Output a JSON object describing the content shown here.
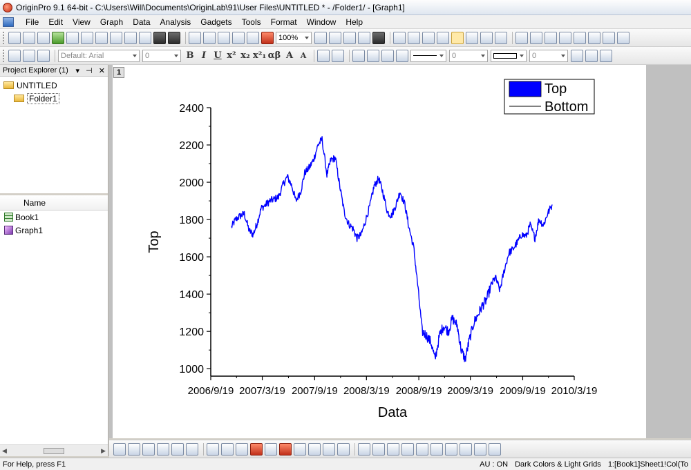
{
  "window": {
    "title": "OriginPro 9.1 64-bit - C:\\Users\\Will\\Documents\\OriginLab\\91\\User Files\\UNTITLED * - /Folder1/ - [Graph1]"
  },
  "menu": [
    "File",
    "Edit",
    "View",
    "Graph",
    "Data",
    "Analysis",
    "Gadgets",
    "Tools",
    "Format",
    "Window",
    "Help"
  ],
  "toolbar": {
    "zoom": "100%",
    "font": "Default: Arial",
    "font_size": "0",
    "line_width": "0",
    "fill_size": "0"
  },
  "format_buttons": [
    "B",
    "I",
    "U",
    "x²",
    "x₂",
    "x²₁",
    "αβ",
    "A",
    "A"
  ],
  "explorer": {
    "title": "Project Explorer (1)",
    "root": "UNTITLED",
    "folder": "Folder1",
    "list_header": "Name",
    "items": [
      {
        "name": "Book1",
        "icon": "workbook-icon"
      },
      {
        "name": "Graph1",
        "icon": "graph-icon"
      }
    ]
  },
  "graph": {
    "layer_label": "1"
  },
  "status": {
    "help": "For Help, press F1",
    "au": "AU : ON",
    "theme": "Dark Colors & Light Grids",
    "ref": "1:[Book1]Sheet1!Col(To"
  },
  "chart_data": {
    "type": "line",
    "title": "",
    "xlabel": "Data",
    "ylabel": "Top",
    "x_ticks": [
      "2006/9/19",
      "2007/3/19",
      "2007/9/19",
      "2008/3/19",
      "2008/9/19",
      "2009/3/19",
      "2009/9/19",
      "2010/3/19"
    ],
    "y_ticks": [
      1000,
      1200,
      1400,
      1600,
      1800,
      2000,
      2200,
      2400
    ],
    "xlim": [
      "2006/9/19",
      "2010/3/19"
    ],
    "ylim": [
      960,
      2400
    ],
    "legend": {
      "position": "top-right",
      "entries": [
        "Top",
        "Bottom"
      ]
    },
    "grid": false,
    "color": "#0000ff",
    "series": [
      {
        "name": "Top",
        "x": [
          "2006/12/1",
          "2006/12/15",
          "2007/1/1",
          "2007/1/15",
          "2007/2/1",
          "2007/2/15",
          "2007/3/1",
          "2007/3/15",
          "2007/4/1",
          "2007/4/15",
          "2007/5/1",
          "2007/5/15",
          "2007/6/1",
          "2007/6/15",
          "2007/7/1",
          "2007/7/15",
          "2007/8/1",
          "2007/8/15",
          "2007/9/1",
          "2007/9/15",
          "2007/10/1",
          "2007/10/15",
          "2007/11/1",
          "2007/11/15",
          "2007/12/1",
          "2007/12/15",
          "2008/1/1",
          "2008/1/15",
          "2008/2/1",
          "2008/2/15",
          "2008/3/1",
          "2008/3/15",
          "2008/4/1",
          "2008/4/15",
          "2008/5/1",
          "2008/5/15",
          "2008/6/1",
          "2008/6/15",
          "2008/7/1",
          "2008/7/15",
          "2008/8/1",
          "2008/8/15",
          "2008/9/1",
          "2008/9/15",
          "2008/10/1",
          "2008/10/15",
          "2008/11/1",
          "2008/11/15",
          "2008/12/1",
          "2008/12/15",
          "2009/1/1",
          "2009/1/15",
          "2009/2/1",
          "2009/2/15",
          "2009/3/1",
          "2009/3/15",
          "2009/4/1",
          "2009/4/15",
          "2009/5/1",
          "2009/5/15",
          "2009/6/1",
          "2009/6/15",
          "2009/7/1",
          "2009/7/15",
          "2009/8/1",
          "2009/8/15",
          "2009/9/1",
          "2009/9/15",
          "2009/10/1",
          "2009/10/15",
          "2009/11/1",
          "2009/11/15",
          "2009/12/1",
          "2009/12/15",
          "2010/1/1"
        ],
        "y": [
          1760,
          1800,
          1820,
          1830,
          1740,
          1720,
          1780,
          1860,
          1880,
          1900,
          1910,
          1920,
          1990,
          2030,
          1980,
          1900,
          1950,
          2050,
          2080,
          2120,
          2200,
          2230,
          2040,
          2120,
          2130,
          1990,
          1840,
          1780,
          1750,
          1700,
          1720,
          1790,
          1880,
          1980,
          2020,
          1950,
          1840,
          1820,
          1880,
          1950,
          1880,
          1760,
          1650,
          1450,
          1200,
          1180,
          1140,
          1050,
          1180,
          1230,
          1200,
          1270,
          1230,
          1100,
          1050,
          1150,
          1250,
          1290,
          1340,
          1370,
          1450,
          1490,
          1420,
          1520,
          1620,
          1640,
          1680,
          1720,
          1710,
          1770,
          1700,
          1800,
          1770,
          1830,
          1880
        ]
      }
    ]
  }
}
